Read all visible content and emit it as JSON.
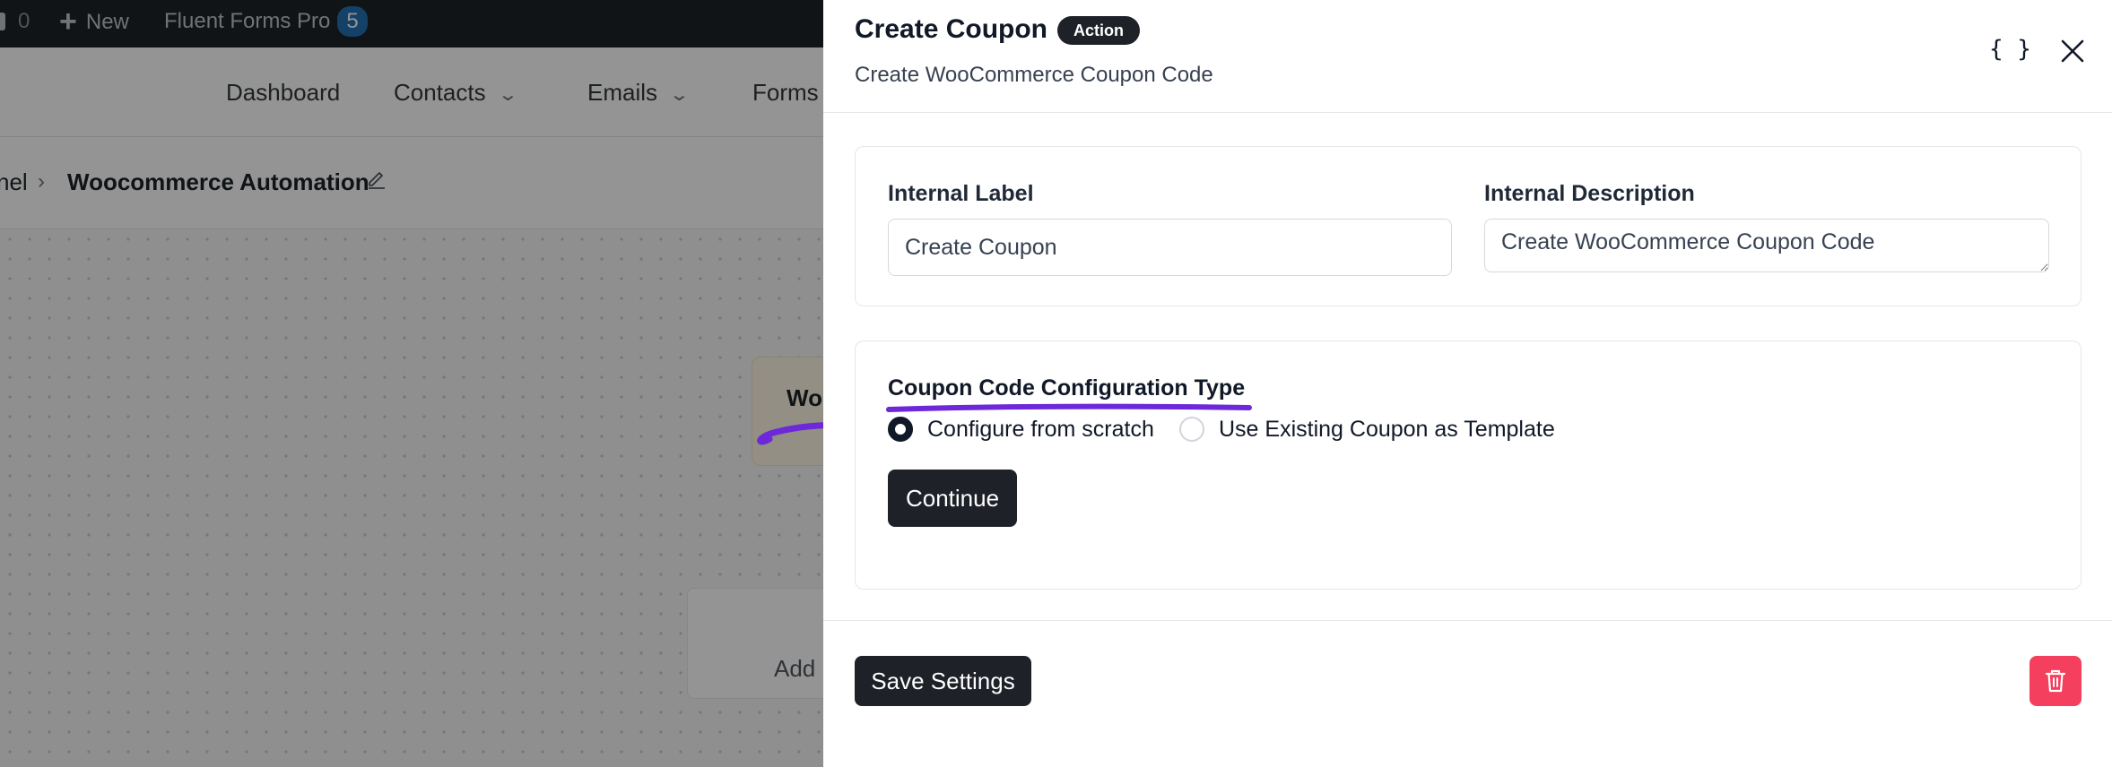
{
  "admin_bar": {
    "comment_count": "0",
    "new_label": "New",
    "plugin_name": "Fluent Forms Pro",
    "plugin_badge": "5"
  },
  "top_nav": {
    "items": [
      {
        "label": "Dashboard"
      },
      {
        "label": "Contacts"
      },
      {
        "label": "Emails"
      },
      {
        "label": "Forms"
      }
    ]
  },
  "breadcrumb": {
    "parent": "nel",
    "current": "Woocommerce Automation"
  },
  "canvas": {
    "node_title": "Wo",
    "add_label": "Add"
  },
  "drawer": {
    "title": "Create Coupon",
    "badge": "Action",
    "subtitle": "Create WooCommerce Coupon Code",
    "code_icon": "{ }",
    "internal_label": {
      "label": "Internal Label",
      "value": "Create Coupon"
    },
    "internal_description": {
      "label": "Internal Description",
      "value": "Create WooCommerce Coupon Code"
    },
    "config": {
      "label": "Coupon Code Configuration Type",
      "options": [
        {
          "label": "Configure from scratch",
          "selected": true
        },
        {
          "label": "Use Existing Coupon as Template",
          "selected": false
        }
      ],
      "continue_label": "Continue"
    },
    "footer": {
      "save_label": "Save Settings"
    }
  },
  "colors": {
    "dark_button": "#1f2128",
    "delete_button": "#f43f5e",
    "annotation": "#6d28d9",
    "admin_bar": "#1d2327"
  },
  "icons": [
    "plus-icon",
    "chevron-down-icon",
    "chevron-right-icon",
    "edit-pencil-icon",
    "code-braces-icon",
    "close-icon",
    "trash-icon",
    "annotation-arrow"
  ]
}
